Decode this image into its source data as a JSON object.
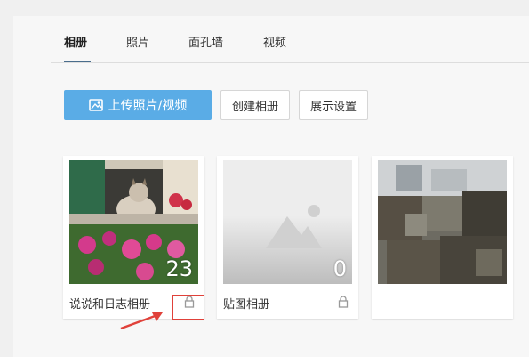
{
  "tabs": [
    {
      "label": "相册",
      "active": true
    },
    {
      "label": "照片",
      "active": false
    },
    {
      "label": "面孔墙",
      "active": false
    },
    {
      "label": "视频",
      "active": false
    }
  ],
  "toolbar": {
    "upload_label": "上传照片/视频",
    "create_label": "创建相册",
    "display_label": "展示设置"
  },
  "albums": [
    {
      "title": "说说和日志相册",
      "count": "23",
      "locked": true
    },
    {
      "title": "贴图相册",
      "count": "0",
      "locked": true
    },
    {
      "title": "",
      "count": "",
      "locked": false
    }
  ],
  "colors": {
    "primary": "#5aace6",
    "annotation": "#e0413a"
  }
}
